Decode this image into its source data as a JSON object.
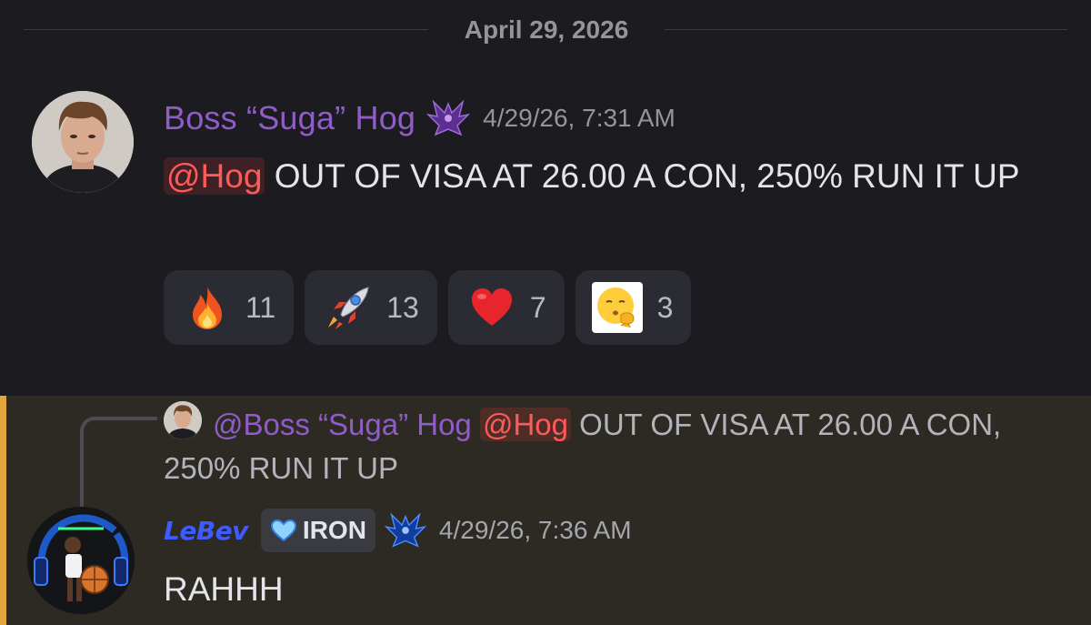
{
  "date_divider": "April 29, 2026",
  "message1": {
    "username": "Boss “Suga” Hog",
    "timestamp": "4/29/26, 7:31 AM",
    "mention": "@Hog",
    "text": " OUT OF VISA AT 26.00 A CON, 250% RUN IT UP",
    "reactions": [
      {
        "icon": "fire-emoji",
        "count": "11"
      },
      {
        "icon": "rocket-emoji",
        "count": "13"
      },
      {
        "icon": "red-heart-emoji",
        "count": "7"
      },
      {
        "icon": "shushing-face-emoji",
        "count": "3"
      }
    ]
  },
  "message2": {
    "reply": {
      "username": "@Boss “Suga” Hog",
      "mention": "@Hog",
      "text": " OUT OF VISA AT 26.00 A CON, 250% RUN IT UP"
    },
    "username": "LeBev",
    "tag": "IRON",
    "timestamp": "4/29/26, 7:36 AM",
    "text": "RAHHH"
  },
  "colors": {
    "background": "#1b1b20",
    "highlight_background": "#2d2a23",
    "highlight_bar": "#e3a53c",
    "username1": "#8f5cc8",
    "username2": "#3d5bff",
    "mention": "#ff5a5a"
  }
}
